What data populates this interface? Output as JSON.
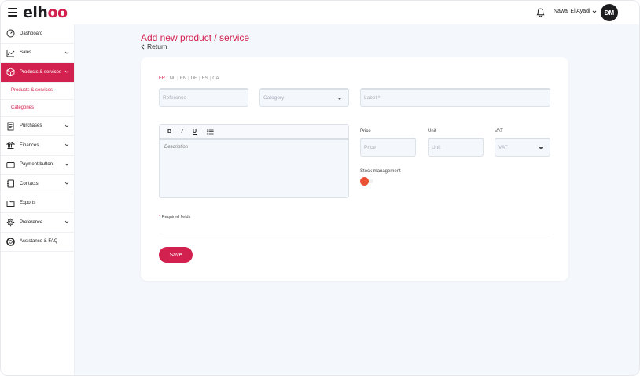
{
  "header": {
    "logo_prefix": "elh",
    "logo_accent": "oo",
    "user_name": "Nawal El Ayadi",
    "avatar_initials": "ÐM"
  },
  "sidebar": {
    "items": [
      {
        "label": "Dashboard",
        "icon": "dashboard-icon"
      },
      {
        "label": "Sales",
        "icon": "chart-line-icon"
      },
      {
        "label": "Products & services",
        "icon": "box-icon"
      },
      {
        "label": "Purchases",
        "icon": "receipt-icon"
      },
      {
        "label": "Finances",
        "icon": "bank-icon"
      },
      {
        "label": "Payment button",
        "icon": "card-icon"
      },
      {
        "label": "Contacts",
        "icon": "contacts-icon"
      },
      {
        "label": "Exports",
        "icon": "folder-icon"
      },
      {
        "label": "Preference",
        "icon": "gear-icon"
      },
      {
        "label": "Assistance & FAQ",
        "icon": "lifebuoy-icon"
      }
    ],
    "sub_items": [
      "Products & services",
      "Categories"
    ]
  },
  "page": {
    "title": "Add new product / service",
    "return_label": "Return"
  },
  "form": {
    "languages": [
      "FR",
      "NL",
      "EN",
      "DE",
      "ES",
      "CA"
    ],
    "reference_placeholder": "Reference",
    "category_placeholder": "Category",
    "label_placeholder": "Label *",
    "editor": {
      "bold": "B",
      "italic": "I",
      "underline": "U",
      "description_placeholder": "Description"
    },
    "price_label": "Price",
    "price_placeholder": "Price",
    "unit_label": "Unit",
    "unit_placeholder": "Unit",
    "vat_label": "VAT",
    "vat_placeholder": "VAT",
    "stock_label": "Stock management",
    "required_note": "Required fields",
    "required_star": "*",
    "save_label": "Save"
  },
  "colors": {
    "brand": "#d3214f",
    "toggle_knob": "#ea5235"
  }
}
